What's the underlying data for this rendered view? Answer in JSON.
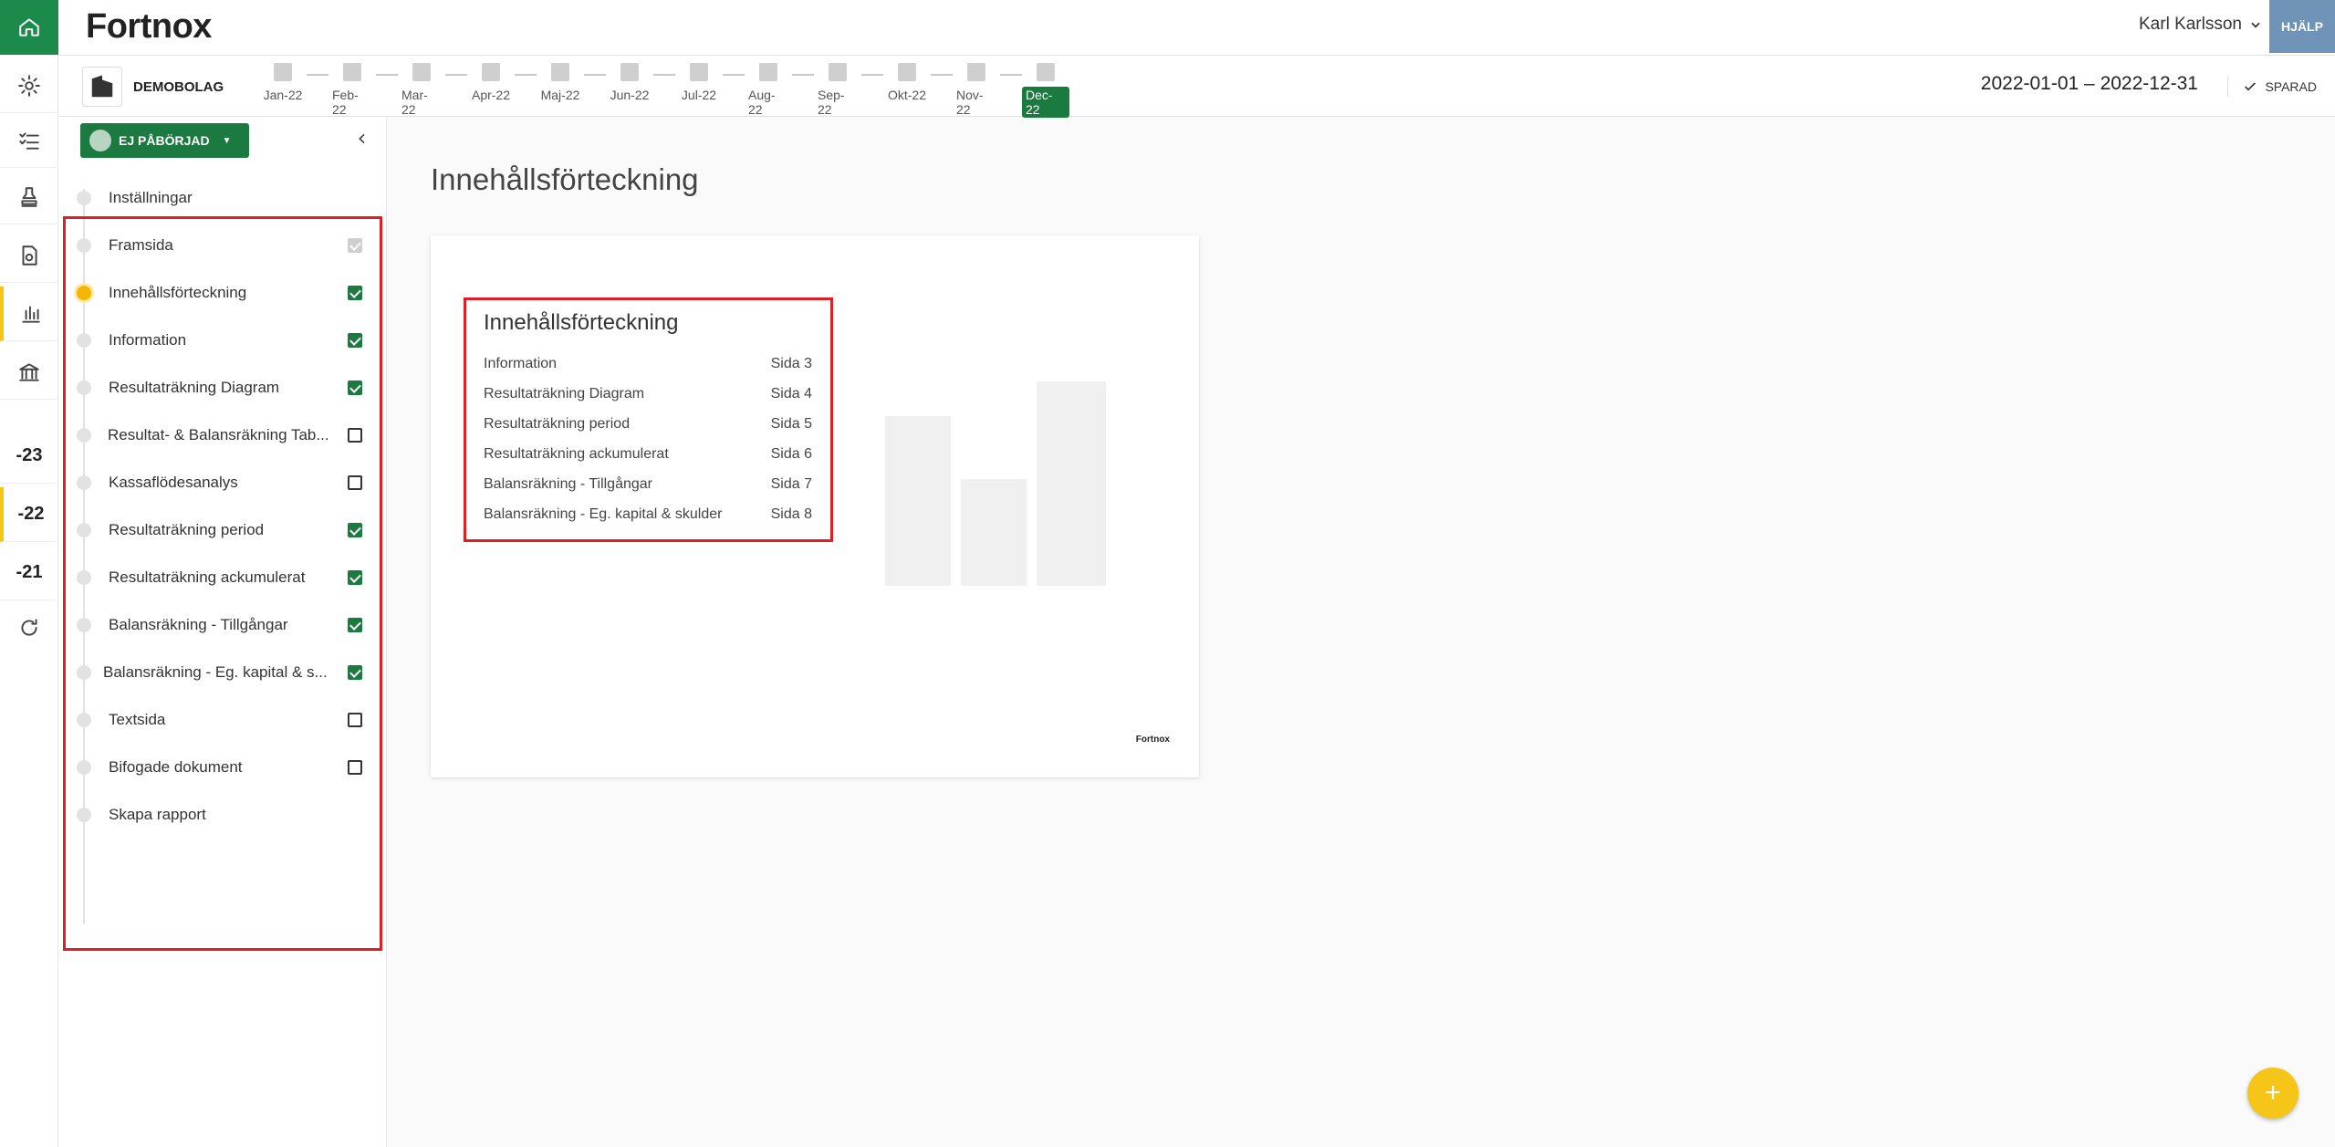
{
  "app": {
    "logo": "Fortnox",
    "user_name": "Karl Karlsson",
    "help_label": "HJÄLP"
  },
  "rail": {
    "items": [
      "home-icon",
      "gear-icon",
      "checklist-icon",
      "stamp-icon",
      "document-icon",
      "chart-icon",
      "bank-icon"
    ],
    "years": [
      "-23",
      "-22",
      "-21"
    ],
    "refresh": "refresh-icon"
  },
  "periodbar": {
    "company": "DEMOBOLAG",
    "months": [
      "Jan-22",
      "Feb-22",
      "Mar-22",
      "Apr-22",
      "Maj-22",
      "Jun-22",
      "Jul-22",
      "Aug-22",
      "Sep-22",
      "Okt-22",
      "Nov-22",
      "Dec-22"
    ],
    "active_month": "Dec-22",
    "date_range": "2022-01-01 – 2022-12-31",
    "saved_label": "SPARAD"
  },
  "sidebar": {
    "status_label": "EJ PÅBÖRJAD",
    "steps": [
      {
        "label": "Inställningar",
        "check": "none"
      },
      {
        "label": "Framsida",
        "check": "disabled"
      },
      {
        "label": "Innehållsförteckning",
        "check": "on",
        "current": true
      },
      {
        "label": "Information",
        "check": "on"
      },
      {
        "label": "Resultaträkning Diagram",
        "check": "on"
      },
      {
        "label": "Resultat- & Balansräkning Tab...",
        "check": "off"
      },
      {
        "label": "Kassaflödesanalys",
        "check": "off"
      },
      {
        "label": "Resultaträkning period",
        "check": "on"
      },
      {
        "label": "Resultaträkning ackumulerat",
        "check": "on"
      },
      {
        "label": "Balansräkning - Tillgångar",
        "check": "on"
      },
      {
        "label": "Balansräkning - Eg. kapital & s...",
        "check": "on"
      },
      {
        "label": "Textsida",
        "check": "off"
      },
      {
        "label": "Bifogade dokument",
        "check": "off"
      },
      {
        "label": "Skapa rapport",
        "check": "none"
      }
    ]
  },
  "main": {
    "title": "Innehållsförteckning",
    "toc_title": "Innehållsförteckning",
    "toc": [
      {
        "name": "Information",
        "page": "Sida 3"
      },
      {
        "name": "Resultaträkning Diagram",
        "page": "Sida 4"
      },
      {
        "name": "Resultaträkning period",
        "page": "Sida 5"
      },
      {
        "name": "Resultaträkning ackumulerat",
        "page": "Sida 6"
      },
      {
        "name": "Balansräkning - Tillgångar",
        "page": "Sida 7"
      },
      {
        "name": "Balansräkning - Eg. kapital & skulder",
        "page": "Sida 8"
      }
    ],
    "card_logo": "Fortnox",
    "fab_label": "+"
  },
  "colors": {
    "brand_green": "#1b7a3f",
    "accent_yellow": "#f5c518",
    "highlight_red": "#e01e26",
    "help_blue": "#6f94b7"
  }
}
